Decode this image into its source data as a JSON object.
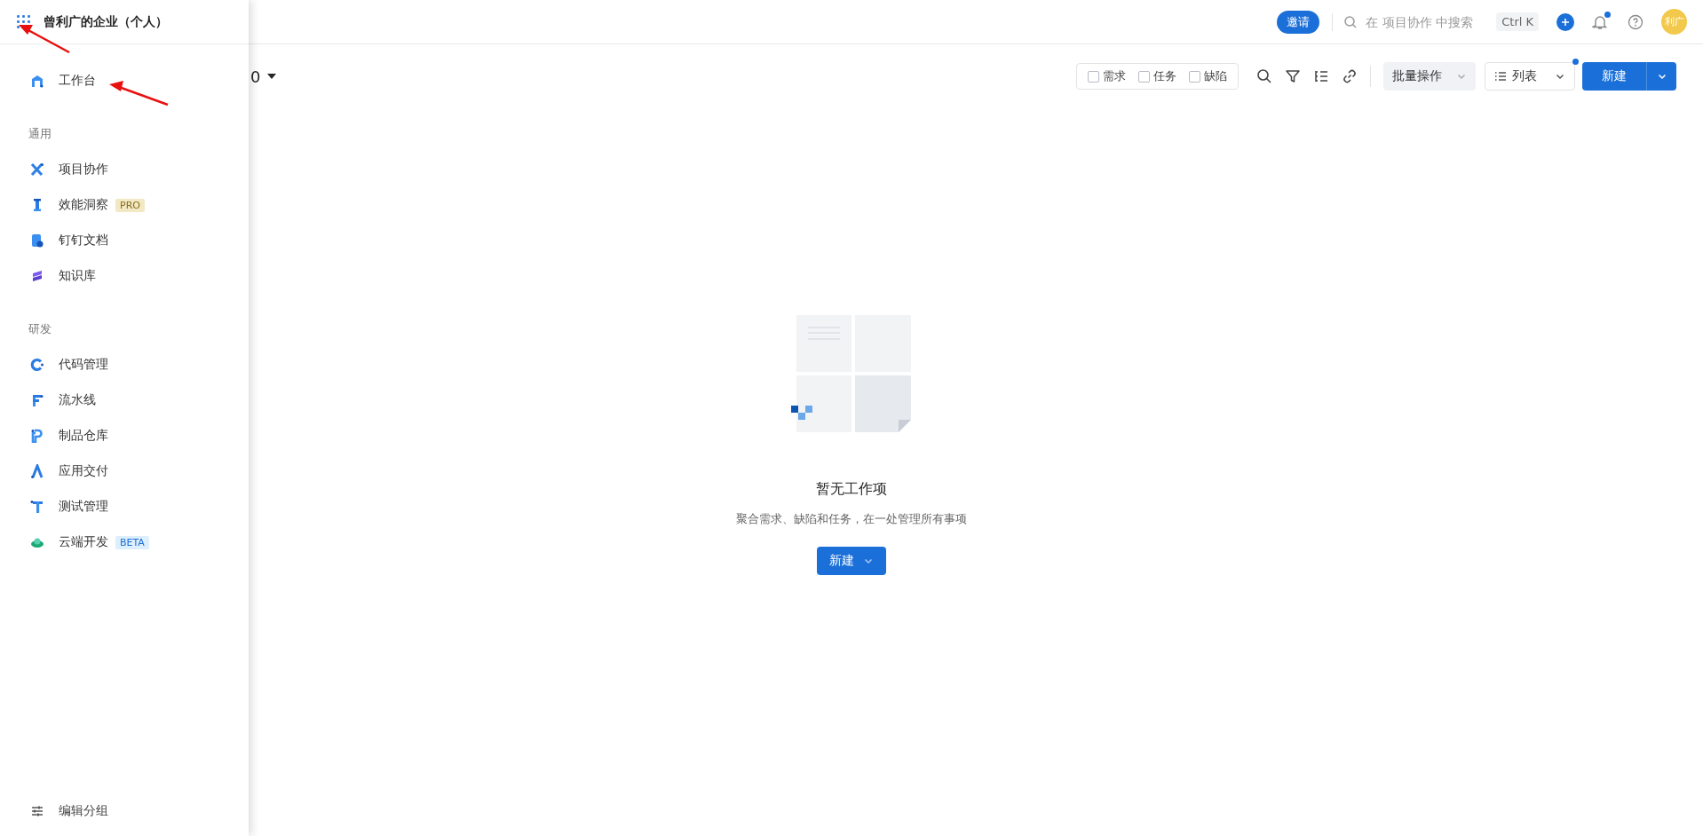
{
  "sidebar": {
    "title": "曾利广的企业（个人）",
    "pinned": [
      {
        "label": "工作台",
        "kind": "workbench"
      }
    ],
    "groups": [
      {
        "heading": "通用",
        "items": [
          {
            "label": "项目协作",
            "kind": "cross"
          },
          {
            "label": "效能洞察",
            "kind": "pillar",
            "badge": {
              "text": "PRO",
              "kind": "pro"
            }
          },
          {
            "label": "钉钉文档",
            "kind": "doc"
          },
          {
            "label": "知识库",
            "kind": "stack"
          }
        ]
      },
      {
        "heading": "研发",
        "items": [
          {
            "label": "代码管理",
            "kind": "arc"
          },
          {
            "label": "流水线",
            "kind": "flag"
          },
          {
            "label": "制品仓库",
            "kind": "hook"
          },
          {
            "label": "应用交付",
            "kind": "peak"
          },
          {
            "label": "测试管理",
            "kind": "tee"
          },
          {
            "label": "云端开发",
            "kind": "cloud",
            "badge": {
              "text": "BETA",
              "kind": "beta"
            }
          }
        ]
      }
    ],
    "footer": "编辑分组"
  },
  "header": {
    "invite": "邀请",
    "search": {
      "placeholder": "在 项目协作 中搜索"
    },
    "shortcut": "Ctrl K",
    "notifications_unread": true,
    "avatar": "利广"
  },
  "toolbar": {
    "title_fragment": "0",
    "type_filters": [
      {
        "label": "需求",
        "checked": false
      },
      {
        "label": "任务",
        "checked": false
      },
      {
        "label": "缺陷",
        "checked": false
      }
    ],
    "batch": "批量操作",
    "view": {
      "label": "列表",
      "dot": true
    },
    "new_button": "新建"
  },
  "empty_state": {
    "title": "暂无工作项",
    "description": "聚合需求、缺陷和任务，在一处管理所有事项",
    "button": "新建"
  }
}
